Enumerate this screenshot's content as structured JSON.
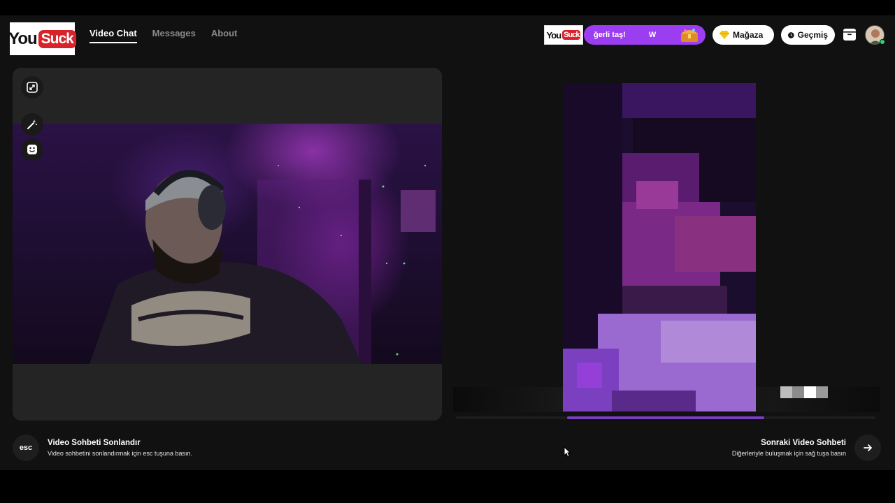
{
  "brand": {
    "logo_you": "You",
    "logo_suck": "Suck"
  },
  "nav": {
    "items": [
      {
        "label": "Video Chat",
        "active": true
      },
      {
        "label": "Messages",
        "active": false
      },
      {
        "label": "About",
        "active": false
      }
    ]
  },
  "promo": {
    "text": "ğerli taş!",
    "text2": "W",
    "icon": "treasure-chest-icon",
    "color": "#9b3df0"
  },
  "header_buttons": {
    "store_label": "Mağaza",
    "store_icon": "diamond-icon",
    "history_label": "Geçmiş",
    "history_icon": "clock-icon",
    "archive_icon": "archive-box-icon"
  },
  "user": {
    "avatar": "user-avatar",
    "status_color": "#2fd36a"
  },
  "left_panel": {
    "tools": [
      "fullscreen-icon",
      "magic-wand-icon",
      "face-filter-icon"
    ]
  },
  "remote": {
    "progress_color": "#7a3fc0",
    "progress": 0.47
  },
  "bottom": {
    "end": {
      "key": "esc",
      "title": "Video Sohbeti Sonlandır",
      "subtitle": "Video sohbetini sonlandırmak için esc tuşuna basın."
    },
    "next": {
      "title": "Sonraki Video Sohbeti",
      "subtitle": "Diğerleriyle buluşmak için sağ tuşa basın",
      "icon": "arrow-right-icon"
    }
  },
  "colors": {
    "background": "#111111",
    "panel": "#242424",
    "accent": "#9b3df0",
    "brand_red": "#d8232a"
  }
}
